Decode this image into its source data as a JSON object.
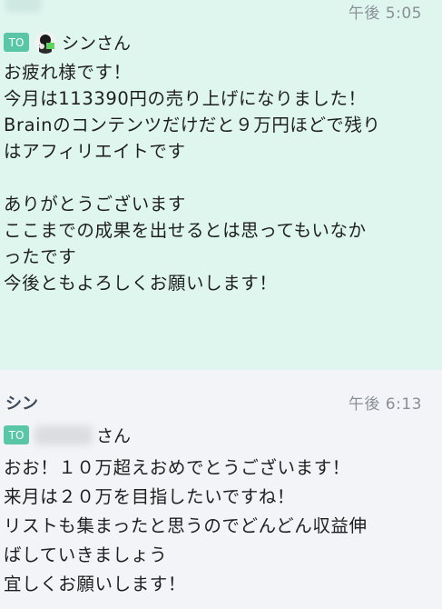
{
  "messages": [
    {
      "time": "午後 5:05",
      "to_label": "TO",
      "to_name": "シンさん",
      "body": "お疲れ様です！\n今月は113390円の売り上げになりました！\nBrainのコンテンツだけだと９万円ほどで残り\nはアフィリエイトです\n\nありがとうございます\nここまでの成果を出せるとは思ってもいなか\nったです\n今後ともよろしくお願いします！"
    },
    {
      "sender": "シン",
      "time": "午後 6:13",
      "to_label": "TO",
      "to_suffix": "さん",
      "body": "おお！１０万超えおめでとうございます！\n来月は２０万を目指したいですね！\nリストも集まったと思うのでどんどん収益伸\nばしていきましょう\n宜しくお願いします！"
    }
  ],
  "colors": {
    "highlight_bg": "#dff6ef",
    "normal_bg": "#f3f4f8",
    "to_badge": "#59c6a5"
  }
}
